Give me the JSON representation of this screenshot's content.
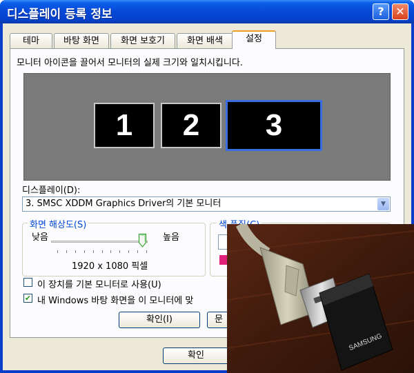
{
  "window": {
    "title": "디스플레이 등록 정보",
    "help_glyph": "?",
    "close_glyph": "✕"
  },
  "tabs": [
    "테마",
    "바탕 화면",
    "화면 보호기",
    "화면 배색",
    "설정"
  ],
  "active_tab": "설정",
  "settings": {
    "instruction": "모니터 아이콘을 끌어서 모니터의 실제 크기와 일치시킵니다.",
    "monitors": [
      "1",
      "2",
      "3"
    ],
    "display_label": "디스플레이(D):",
    "display_value": "3.  SMSC XDDM Graphics Driver의 기본 모니터",
    "resolution": {
      "legend": "화면 해상도(S)",
      "low_label": "낮음",
      "high_label": "높음",
      "value_text": "1920 x 1080 픽셀",
      "slider_position": 0.95
    },
    "color_quality": {
      "legend": "색 품질(C)"
    },
    "primary_checkbox": {
      "label": "이 장치를 기본 모니터로 사용(U)",
      "checked": false
    },
    "extend_checkbox": {
      "label": "내 Windows 바탕 화면을 이 모니터에 맞",
      "checked": true,
      "check_glyph": "✔"
    },
    "inner_ok": "확인(I)",
    "inner_second_partial": "문"
  },
  "dialog_buttons": {
    "ok": "확인"
  },
  "photo": {
    "brand": "SAMSUNG"
  },
  "colors": {
    "titlebar": "#0548d8",
    "face": "#ece9d8",
    "accent": "#0046d5",
    "monitor_bg": "#7b7b7b"
  }
}
